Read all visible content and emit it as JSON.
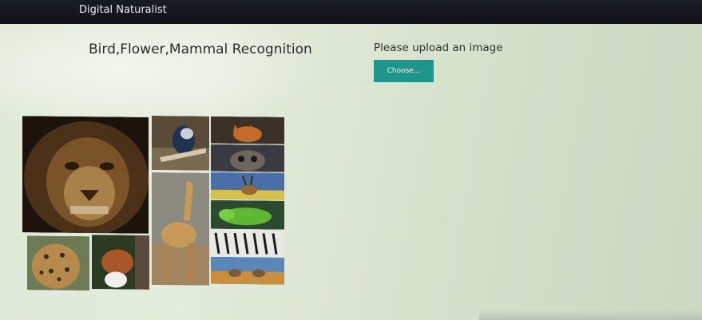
{
  "navbar": {
    "brand": "Digital Naturalist"
  },
  "main": {
    "title": "Bird,Flower,Mammal Recognition",
    "upload_label": "Please upload an image",
    "choose_button": "Choose..."
  },
  "collage": {
    "tiles": [
      "lion",
      "bird",
      "fox",
      "owl",
      "giraffe",
      "antelope",
      "iguana",
      "zebras",
      "elephants",
      "leopard",
      "red-panda"
    ]
  }
}
